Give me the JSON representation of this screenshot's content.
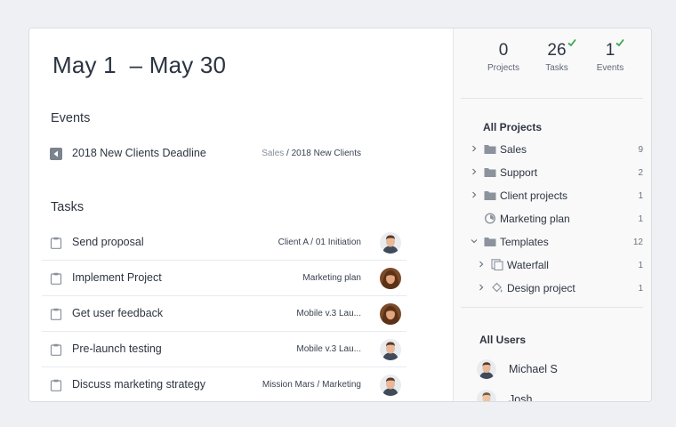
{
  "header": {
    "date_range": "May 1  – May 30"
  },
  "events": {
    "title": "Events",
    "items": [
      {
        "title": "2018 New Clients Deadline",
        "crumb_muted": "Sales",
        "crumb_main": " / 2018 New Clients",
        "icon": "event-flag-icon"
      }
    ]
  },
  "tasks": {
    "title": "Tasks",
    "items": [
      {
        "title": "Send proposal",
        "crumb": "Client A / 01 Initiation",
        "avatar": "man"
      },
      {
        "title": "Implement Project",
        "crumb": "Marketing plan",
        "avatar": "woman"
      },
      {
        "title": "Get user feedback",
        "crumb": "Mobile v.3 Lau...",
        "avatar": "woman"
      },
      {
        "title": "Pre-launch testing",
        "crumb": "Mobile v.3 Lau...",
        "avatar": "man"
      },
      {
        "title": "Discuss marketing strategy",
        "crumb": "Mission Mars / Marketing",
        "avatar": "man"
      }
    ]
  },
  "stats": [
    {
      "value": "0",
      "label": "Projects",
      "checked": false
    },
    {
      "value": "26",
      "label": "Tasks",
      "checked": true
    },
    {
      "value": "1",
      "label": "Events",
      "checked": true
    }
  ],
  "projects": {
    "title": "All Projects",
    "items": [
      {
        "name": "Sales",
        "count": "9",
        "icon": "folder-icon",
        "expanded": false,
        "level": 0
      },
      {
        "name": "Support",
        "count": "2",
        "icon": "folder-icon",
        "expanded": false,
        "level": 0
      },
      {
        "name": "Client projects",
        "count": "1",
        "icon": "folder-icon",
        "expanded": false,
        "level": 0
      },
      {
        "name": "Marketing plan",
        "count": "1",
        "icon": "project-progress-icon",
        "expanded": null,
        "level": 0
      },
      {
        "name": "Templates",
        "count": "12",
        "icon": "folder-icon",
        "expanded": true,
        "level": 0
      },
      {
        "name": "Waterfall",
        "count": "1",
        "icon": "template-icon",
        "expanded": false,
        "level": 1
      },
      {
        "name": "Design project",
        "count": "1",
        "icon": "paint-bucket-icon",
        "expanded": false,
        "level": 1
      }
    ]
  },
  "users": {
    "title": "All Users",
    "items": [
      {
        "name": "Michael S"
      },
      {
        "name": "Josh"
      }
    ]
  },
  "colors": {
    "accent_check": "#3aa655",
    "text": "#2d3540",
    "muted": "#868e99"
  }
}
